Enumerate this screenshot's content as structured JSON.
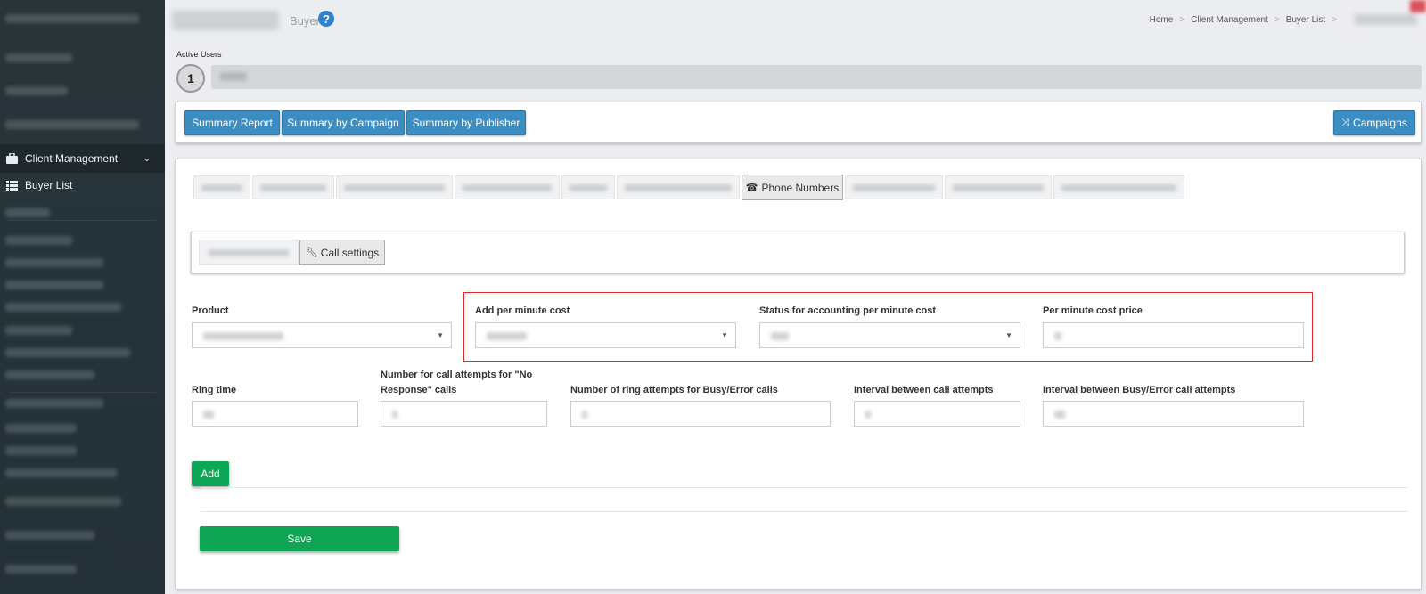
{
  "header": {
    "title": "Buyer",
    "breadcrumb": [
      "Home",
      "Client Management",
      "Buyer List"
    ]
  },
  "sidebar": {
    "client_management": "Client Management",
    "buyer_list": "Buyer List"
  },
  "active_users": {
    "label": "Active Users",
    "count": "1"
  },
  "report_bar": {
    "summary_report": "Summary Report",
    "summary_by_campaign": "Summary by Campaign",
    "summary_by_publisher": "Summary by Publisher",
    "campaigns": "Campaigns"
  },
  "tabs": {
    "active": "Phone Numbers"
  },
  "subtabs": {
    "active": "Call settings"
  },
  "form": {
    "product_label": "Product",
    "add_per_minute_cost_label": "Add per minute cost",
    "status_accounting_label": "Status for accounting per minute cost",
    "per_minute_cost_price_label": "Per minute cost price",
    "ring_time_label": "Ring time",
    "no_response_attempts_label": "Number for call attempts for \"No Response\" calls",
    "busy_error_attempts_label": "Number of ring attempts for Busy/Error calls",
    "interval_label": "Interval between call attempts",
    "interval_busy_label": "Interval between Busy/Error call attempts",
    "add_button": "Add",
    "save_button": "Save"
  },
  "colors": {
    "primary_blue": "#3c8dc2",
    "success_green": "#0ea654",
    "highlight_red": "#e0272c"
  }
}
